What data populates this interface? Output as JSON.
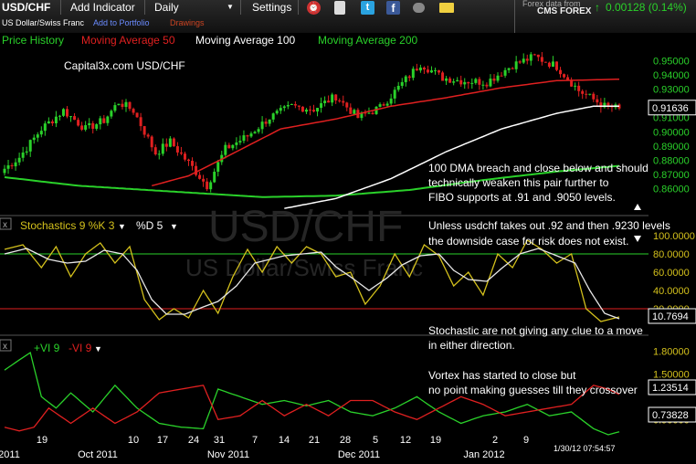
{
  "toolbar": {
    "symbol": "USD/CHF",
    "add_indicator": "Add Indicator",
    "interval": "Daily",
    "settings": "Settings",
    "symbol_desc": "US Dollar/Swiss Franc",
    "add_portfolio": "Add to Portfolio",
    "drawings": "Drawings",
    "forex_data_from": "Forex data from",
    "provider": "CMS FOREX",
    "change": "0.00128 (0.14%)",
    "change_arrow": "↑",
    "icons": [
      "alarm-clock-icon",
      "document-icon",
      "twitter-icon",
      "facebook-icon",
      "link-icon",
      "email-icon"
    ]
  },
  "chart_data": [
    {
      "type": "candlestick",
      "legend": [
        {
          "name": "Price History",
          "color": "#2ad12a"
        },
        {
          "name": "Moving Average 50",
          "color": "#e02020"
        },
        {
          "name": "Moving Average 100",
          "color": "#ffffff"
        },
        {
          "name": "Moving Average 200",
          "color": "#2ad12a"
        }
      ],
      "annotation": "Capital3x.com USD/CHF",
      "watermark": "USD/CHF",
      "watermark2": "US Dollar/Swiss Franc",
      "ylim": [
        0.85,
        0.96
      ],
      "yticks": [
        "0.95000",
        "0.94000",
        "0.93000",
        "0.92000",
        "0.91000",
        "0.90000",
        "0.89000",
        "0.88000",
        "0.87000",
        "0.86000"
      ],
      "yticks_values": [
        0.95,
        0.94,
        0.93,
        0.92,
        0.91,
        0.9,
        0.89,
        0.88,
        0.87,
        0.86
      ],
      "last_value": "0.91636",
      "close_anchors": [
        [
          0,
          0.874
        ],
        [
          4,
          0.882
        ],
        [
          10,
          0.902
        ],
        [
          16,
          0.915
        ],
        [
          22,
          0.902
        ],
        [
          27,
          0.908
        ],
        [
          31,
          0.921
        ],
        [
          35,
          0.915
        ],
        [
          41,
          0.885
        ],
        [
          45,
          0.893
        ],
        [
          51,
          0.875
        ],
        [
          55,
          0.862
        ],
        [
          60,
          0.888
        ],
        [
          66,
          0.897
        ],
        [
          72,
          0.91
        ],
        [
          78,
          0.918
        ],
        [
          84,
          0.916
        ],
        [
          90,
          0.925
        ],
        [
          96,
          0.91
        ],
        [
          102,
          0.917
        ],
        [
          108,
          0.934
        ],
        [
          113,
          0.948
        ],
        [
          119,
          0.938
        ],
        [
          124,
          0.936
        ],
        [
          131,
          0.935
        ],
        [
          138,
          0.947
        ],
        [
          144,
          0.953
        ],
        [
          150,
          0.946
        ],
        [
          156,
          0.929
        ],
        [
          163,
          0.918
        ],
        [
          167,
          0.9164
        ]
      ],
      "ma50_anchors": [
        [
          40,
          0.862
        ],
        [
          50,
          0.869
        ],
        [
          60,
          0.882
        ],
        [
          75,
          0.902
        ],
        [
          90,
          0.909
        ],
        [
          105,
          0.918
        ],
        [
          120,
          0.924
        ],
        [
          135,
          0.931
        ],
        [
          150,
          0.936
        ],
        [
          167,
          0.937
        ]
      ],
      "ma100_anchors": [
        [
          76,
          0.846
        ],
        [
          90,
          0.853
        ],
        [
          105,
          0.867
        ],
        [
          120,
          0.886
        ],
        [
          135,
          0.902
        ],
        [
          150,
          0.913
        ],
        [
          160,
          0.918
        ],
        [
          167,
          0.918
        ]
      ],
      "ma200_anchors": [
        [
          0,
          0.868
        ],
        [
          20,
          0.862
        ],
        [
          45,
          0.858
        ],
        [
          70,
          0.854
        ],
        [
          90,
          0.855
        ],
        [
          110,
          0.859
        ],
        [
          130,
          0.866
        ],
        [
          150,
          0.872
        ],
        [
          167,
          0.876
        ]
      ],
      "text_notes": [
        "100 DMA breach and close below and should",
        "technically weaken this pair further to",
        "FIBO supports at .91 and .9050 levels."
      ]
    },
    {
      "type": "line",
      "title": "Stochastics 9 %K 3",
      "title2": "%D 5",
      "ylim": [
        0,
        100
      ],
      "yticks": [
        "100.0000",
        "80.0000",
        "60.0000",
        "40.0000",
        "20.0000"
      ],
      "yticks_values": [
        100,
        80,
        60,
        40,
        20
      ],
      "levels": [
        80,
        20
      ],
      "last_value": "10.7694",
      "series": [
        {
          "name": "%K",
          "color": "#d4c11c",
          "anchors": [
            [
              0,
              85
            ],
            [
              5,
              90
            ],
            [
              10,
              65
            ],
            [
              14,
              88
            ],
            [
              18,
              55
            ],
            [
              22,
              80
            ],
            [
              26,
              92
            ],
            [
              30,
              70
            ],
            [
              34,
              88
            ],
            [
              38,
              30
            ],
            [
              42,
              8
            ],
            [
              46,
              20
            ],
            [
              50,
              10
            ],
            [
              54,
              40
            ],
            [
              58,
              15
            ],
            [
              62,
              55
            ],
            [
              66,
              85
            ],
            [
              70,
              60
            ],
            [
              74,
              88
            ],
            [
              78,
              70
            ],
            [
              82,
              88
            ],
            [
              86,
              80
            ],
            [
              90,
              55
            ],
            [
              94,
              60
            ],
            [
              98,
              25
            ],
            [
              102,
              45
            ],
            [
              106,
              80
            ],
            [
              110,
              55
            ],
            [
              114,
              90
            ],
            [
              118,
              78
            ],
            [
              122,
              45
            ],
            [
              126,
              60
            ],
            [
              130,
              35
            ],
            [
              134,
              80
            ],
            [
              138,
              65
            ],
            [
              142,
              95
            ],
            [
              146,
              85
            ],
            [
              150,
              70
            ],
            [
              154,
              80
            ],
            [
              158,
              20
            ],
            [
              162,
              6
            ],
            [
              167,
              11
            ]
          ]
        },
        {
          "name": "%D",
          "color": "#e8e8e8",
          "anchors": [
            [
              0,
              80
            ],
            [
              6,
              86
            ],
            [
              12,
              74
            ],
            [
              17,
              70
            ],
            [
              22,
              72
            ],
            [
              27,
              84
            ],
            [
              32,
              80
            ],
            [
              36,
              62
            ],
            [
              40,
              30
            ],
            [
              44,
              14
            ],
            [
              49,
              14
            ],
            [
              54,
              22
            ],
            [
              58,
              28
            ],
            [
              63,
              45
            ],
            [
              68,
              70
            ],
            [
              72,
              74
            ],
            [
              76,
              78
            ],
            [
              81,
              80
            ],
            [
              86,
              82
            ],
            [
              90,
              66
            ],
            [
              95,
              52
            ],
            [
              99,
              40
            ],
            [
              104,
              54
            ],
            [
              108,
              68
            ],
            [
              113,
              78
            ],
            [
              118,
              80
            ],
            [
              122,
              62
            ],
            [
              126,
              52
            ],
            [
              131,
              50
            ],
            [
              135,
              64
            ],
            [
              140,
              80
            ],
            [
              145,
              86
            ],
            [
              150,
              78
            ],
            [
              155,
              70
            ],
            [
              159,
              40
            ],
            [
              163,
              15
            ],
            [
              167,
              9
            ]
          ]
        }
      ]
    },
    {
      "type": "line",
      "title": "+VI 9",
      "title2": "-VI 9",
      "ylim": [
        0.7,
        1.9
      ],
      "yticks": [
        "1.80000",
        "1.50000",
        "0.90000"
      ],
      "yticks_values": [
        1.8,
        1.5,
        0.9
      ],
      "last_values": [
        "1.23514",
        "0.73828"
      ],
      "series": [
        {
          "name": "+VI 9",
          "color": "#2ad12a",
          "anchors": [
            [
              0,
              1.55
            ],
            [
              3,
              1.65
            ],
            [
              7,
              1.78
            ],
            [
              10,
              1.2
            ],
            [
              14,
              1.05
            ],
            [
              18,
              1.25
            ],
            [
              24,
              1.0
            ],
            [
              30,
              1.35
            ],
            [
              36,
              1.05
            ],
            [
              42,
              0.85
            ],
            [
              48,
              0.8
            ],
            [
              54,
              0.78
            ],
            [
              58,
              1.3
            ],
            [
              64,
              1.2
            ],
            [
              70,
              1.1
            ],
            [
              76,
              1.15
            ],
            [
              82,
              1.08
            ],
            [
              88,
              1.15
            ],
            [
              94,
              1.0
            ],
            [
              100,
              0.95
            ],
            [
              106,
              1.05
            ],
            [
              112,
              1.2
            ],
            [
              118,
              1.0
            ],
            [
              124,
              0.85
            ],
            [
              130,
              0.95
            ],
            [
              136,
              1.0
            ],
            [
              142,
              1.1
            ],
            [
              148,
              0.95
            ],
            [
              154,
              1.0
            ],
            [
              160,
              0.78
            ],
            [
              164,
              0.7
            ],
            [
              167,
              0.74
            ]
          ]
        },
        {
          "name": "-VI 9",
          "color": "#e02020",
          "anchors": [
            [
              0,
              0.8
            ],
            [
              4,
              0.75
            ],
            [
              8,
              0.8
            ],
            [
              12,
              1.05
            ],
            [
              18,
              0.85
            ],
            [
              24,
              1.05
            ],
            [
              30,
              0.85
            ],
            [
              36,
              1.0
            ],
            [
              42,
              1.25
            ],
            [
              48,
              1.3
            ],
            [
              54,
              1.35
            ],
            [
              58,
              0.9
            ],
            [
              64,
              0.95
            ],
            [
              70,
              1.15
            ],
            [
              76,
              0.95
            ],
            [
              82,
              1.1
            ],
            [
              88,
              0.95
            ],
            [
              94,
              1.15
            ],
            [
              100,
              1.15
            ],
            [
              106,
              1.0
            ],
            [
              112,
              0.9
            ],
            [
              118,
              1.05
            ],
            [
              124,
              1.2
            ],
            [
              130,
              1.1
            ],
            [
              136,
              0.95
            ],
            [
              142,
              1.0
            ],
            [
              148,
              1.05
            ],
            [
              154,
              1.1
            ],
            [
              160,
              1.35
            ],
            [
              164,
              1.3
            ],
            [
              167,
              1.23
            ]
          ]
        }
      ]
    }
  ],
  "notes": {
    "stoch_notes": [
      "Unless usdchf takes out .92 and then .9230 levels",
      "the downside case for risk does not exist."
    ],
    "vortex_notes_a": [
      "Stochastic are not giving any clue to a move",
      "in either direction."
    ],
    "vortex_notes_b": [
      "Vortex has started to close but",
      "no point making guesses till they crossover"
    ]
  },
  "x_axis": {
    "labels": [
      "2011",
      "19",
      "Oct 2011",
      "10",
      "17",
      "24",
      "31",
      "Nov 2011",
      "7",
      "14",
      "21",
      "28",
      "Dec 2011",
      "5",
      "12",
      "19",
      "Jan 2012",
      "2",
      "9"
    ],
    "timestamp": "1/30/12 07:54:57"
  }
}
